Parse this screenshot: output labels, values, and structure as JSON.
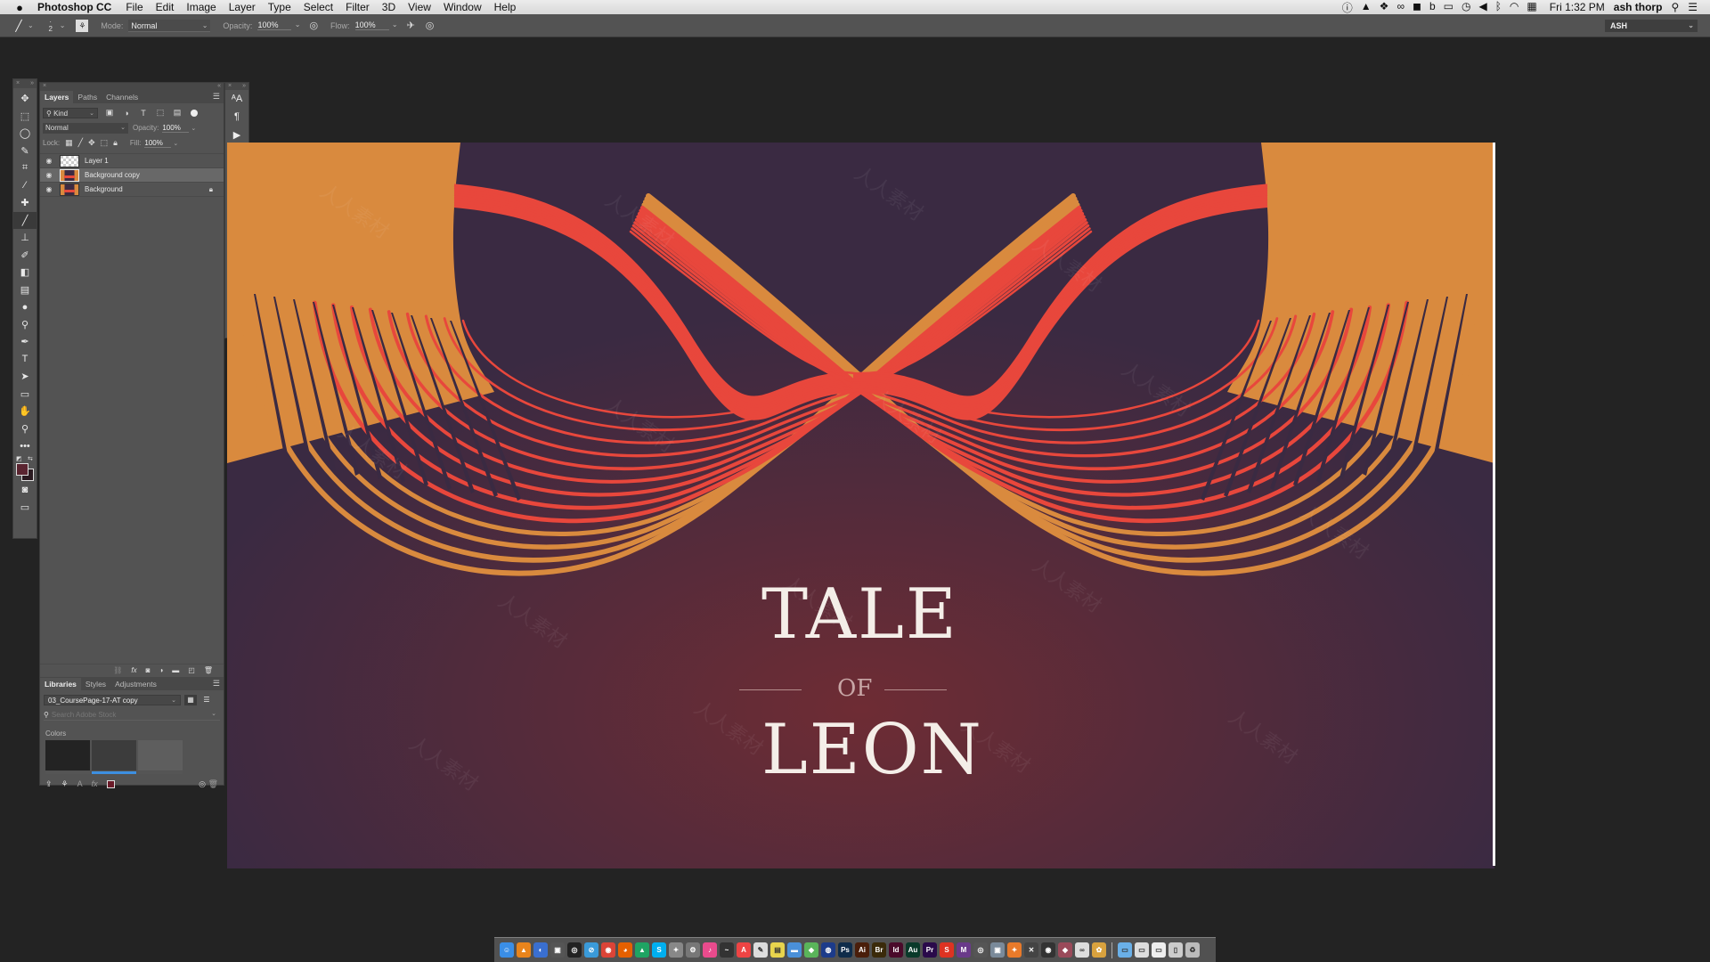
{
  "menubar": {
    "app_name": "Photoshop CC",
    "menus": [
      "File",
      "Edit",
      "Image",
      "Layer",
      "Type",
      "Select",
      "Filter",
      "3D",
      "View",
      "Window",
      "Help"
    ],
    "status_icons": [
      "1password-icon",
      "google-drive-icon",
      "dropbox-icon",
      "creative-cloud-icon",
      "messages-icon",
      "b-icon",
      "display-icon",
      "time-machine-icon",
      "volume-icon",
      "bluetooth-icon",
      "wifi-icon",
      "calendar-icon"
    ],
    "clock": "Fri 1:32 PM",
    "user": "ash thorp"
  },
  "options_bar": {
    "brush_size": "2",
    "mode_label": "Mode:",
    "mode_value": "Normal",
    "opacity_label": "Opacity:",
    "opacity_value": "100%",
    "flow_label": "Flow:",
    "flow_value": "100%",
    "workspace": "ASH"
  },
  "tools": [
    {
      "name": "move-tool",
      "glyph": "✥"
    },
    {
      "name": "marquee-tool",
      "glyph": "⬚"
    },
    {
      "name": "lasso-tool",
      "glyph": "◯"
    },
    {
      "name": "quick-selection-tool",
      "glyph": "✎"
    },
    {
      "name": "crop-tool",
      "glyph": "⌗"
    },
    {
      "name": "eyedropper-tool",
      "glyph": "⁄"
    },
    {
      "name": "healing-brush-tool",
      "glyph": "✚"
    },
    {
      "name": "brush-tool",
      "glyph": "╱",
      "active": true
    },
    {
      "name": "clone-stamp-tool",
      "glyph": "⊥"
    },
    {
      "name": "history-brush-tool",
      "glyph": "✐"
    },
    {
      "name": "eraser-tool",
      "glyph": "◧"
    },
    {
      "name": "gradient-tool",
      "glyph": "▤"
    },
    {
      "name": "blur-tool",
      "glyph": "●"
    },
    {
      "name": "dodge-tool",
      "glyph": "⚲"
    },
    {
      "name": "pen-tool",
      "glyph": "✒"
    },
    {
      "name": "type-tool",
      "glyph": "T"
    },
    {
      "name": "path-selection-tool",
      "glyph": "➤"
    },
    {
      "name": "rectangle-tool",
      "glyph": "▭"
    },
    {
      "name": "hand-tool",
      "glyph": "✋"
    },
    {
      "name": "zoom-tool",
      "glyph": "⚲"
    },
    {
      "name": "more-tools",
      "glyph": "•••"
    }
  ],
  "layers_panel": {
    "tabs": [
      "Layers",
      "Paths",
      "Channels"
    ],
    "active_tab": "Layers",
    "filter_kind": "Kind",
    "blend_mode": "Normal",
    "opacity_label": "Opacity:",
    "opacity_value": "100%",
    "lock_label": "Lock:",
    "fill_label": "Fill:",
    "fill_value": "100%",
    "layers": [
      {
        "name": "Layer 1",
        "visible": true,
        "thumb": "transparent",
        "selected": false,
        "locked": false
      },
      {
        "name": "Background copy",
        "visible": true,
        "thumb": "art",
        "selected": true,
        "locked": false
      },
      {
        "name": "Background",
        "visible": true,
        "thumb": "art",
        "selected": false,
        "locked": true
      }
    ]
  },
  "libraries_panel": {
    "tabs": [
      "Libraries",
      "Styles",
      "Adjustments"
    ],
    "active_tab": "Libraries",
    "library_name": "03_CoursePage-17-AT copy",
    "search_placeholder": "Search Adobe Stock",
    "colors_label": "Colors",
    "colors": [
      "#232323",
      "#3c3c3c",
      "#5e5e5e"
    ],
    "selected_color_index": 1,
    "footer_color": "#6a1a28"
  },
  "right_strip": [
    "character-styles-icon",
    "paragraph-styles-icon",
    "actions-play-icon",
    "properties-icon",
    "info-icon",
    "history-icon",
    "character-icon",
    "paragraph-icon",
    "brushes-icon",
    "color-palette-icon",
    "swatches-grid-icon",
    "adjust-sliders-icon"
  ],
  "artwork": {
    "title_line1": "TALE",
    "title_line2": "OF",
    "title_line3": "LEON",
    "colors": {
      "background": "#3a2a42",
      "glow": "#6e2c34",
      "orange": "#d98a3e",
      "red": "#e8473c",
      "title": "#f4eee8"
    }
  },
  "watermark": "人人素材",
  "dock_apps": [
    {
      "name": "finder",
      "label": "☺",
      "color": "#3a8ee6"
    },
    {
      "name": "vlc",
      "label": "▲",
      "color": "#e8841c"
    },
    {
      "name": "chrome-remote",
      "label": "◐",
      "color": "#3a6fd0"
    },
    {
      "name": "photo-booth",
      "label": "▣",
      "color": "#555"
    },
    {
      "name": "obs",
      "label": "◎",
      "color": "#222"
    },
    {
      "name": "safari",
      "label": "⊘",
      "color": "#3a9ad9"
    },
    {
      "name": "chrome",
      "label": "◉",
      "color": "#db4437"
    },
    {
      "name": "firefox",
      "label": "◕",
      "color": "#e66000"
    },
    {
      "name": "google-drive",
      "label": "▲",
      "color": "#1fa463"
    },
    {
      "name": "skype",
      "label": "S",
      "color": "#00aff0"
    },
    {
      "name": "preview",
      "label": "✦",
      "color": "#888"
    },
    {
      "name": "automator",
      "label": "⚙",
      "color": "#777"
    },
    {
      "name": "itunes",
      "label": "♪",
      "color": "#e94b8d"
    },
    {
      "name": "activity-monitor",
      "label": "~",
      "color": "#333"
    },
    {
      "name": "calendar",
      "label": "A",
      "color": "#e44"
    },
    {
      "name": "textedit",
      "label": "✎",
      "color": "#ddd"
    },
    {
      "name": "stickies",
      "label": "▤",
      "color": "#e8d44d"
    },
    {
      "name": "keynote",
      "label": "▬",
      "color": "#4a90d9"
    },
    {
      "name": "maps",
      "label": "◆",
      "color": "#5ab45a"
    },
    {
      "name": "cinema4d",
      "label": "◍",
      "color": "#1c3b8a"
    },
    {
      "name": "photoshop",
      "label": "Ps",
      "color": "#0f2c4a"
    },
    {
      "name": "illustrator",
      "label": "Ai",
      "color": "#4a1e0a"
    },
    {
      "name": "bridge",
      "label": "Br",
      "color": "#3a2a0a"
    },
    {
      "name": "indesign",
      "label": "Id",
      "color": "#4a0a2a"
    },
    {
      "name": "audition",
      "label": "Au",
      "color": "#0a3a2a"
    },
    {
      "name": "premiere",
      "label": "Pr",
      "color": "#2a0a4a"
    },
    {
      "name": "sketchbook",
      "label": "S",
      "color": "#d32"
    },
    {
      "name": "motion",
      "label": "M",
      "color": "#6a3a8a"
    },
    {
      "name": "app-spiral",
      "label": "◎",
      "color": "#555"
    },
    {
      "name": "app-image",
      "label": "▣",
      "color": "#7a8a9a"
    },
    {
      "name": "app-fox",
      "label": "✦",
      "color": "#e87a2a"
    },
    {
      "name": "app-x",
      "label": "✕",
      "color": "#444"
    },
    {
      "name": "app-scope",
      "label": "◉",
      "color": "#333"
    },
    {
      "name": "app-cube",
      "label": "◆",
      "color": "#9a4a5a"
    },
    {
      "name": "app-link",
      "label": "∞",
      "color": "#ddd"
    },
    {
      "name": "app-flower",
      "label": "✿",
      "color": "#d9a23e"
    }
  ],
  "dock_right": [
    {
      "name": "folder-downloads",
      "label": "▭",
      "color": "#6ab0e8"
    },
    {
      "name": "folder-desktop",
      "label": "▭",
      "color": "#ddd"
    },
    {
      "name": "folder-documents",
      "label": "▭",
      "color": "#eee"
    },
    {
      "name": "folder-stack",
      "label": "▯",
      "color": "#ccc"
    },
    {
      "name": "trash",
      "label": "♻",
      "color": "#bbb"
    }
  ]
}
